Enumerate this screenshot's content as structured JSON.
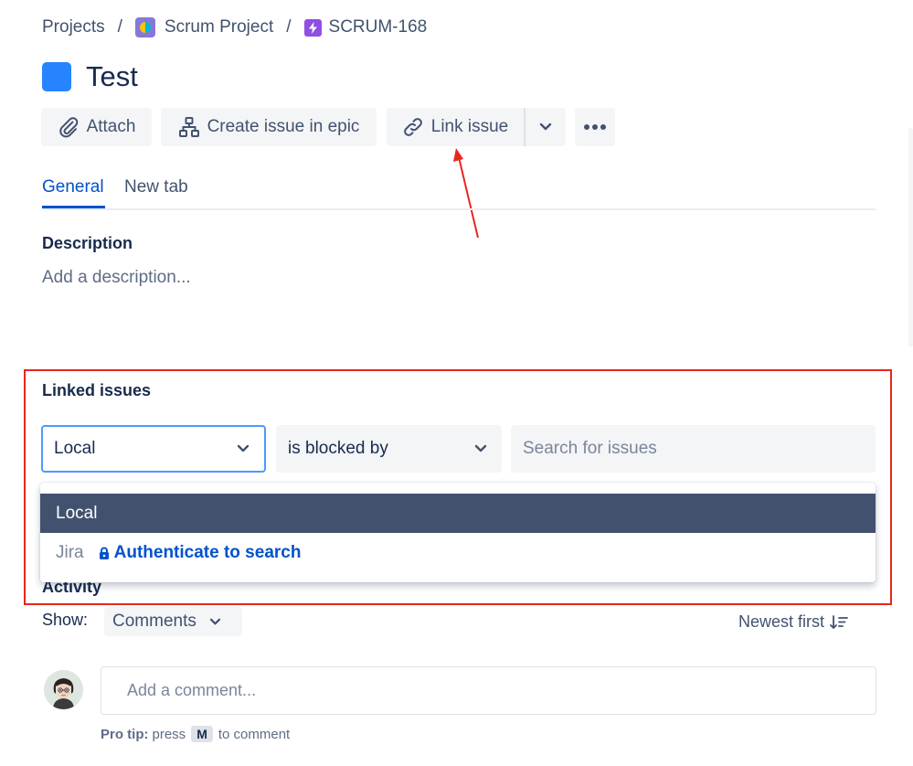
{
  "breadcrumb": {
    "projects": "Projects",
    "separator": "/",
    "project_name": "Scrum Project",
    "issue_key": "SCRUM-168"
  },
  "issue": {
    "title": "Test"
  },
  "toolbar": {
    "attach": "Attach",
    "create_in_epic": "Create issue in epic",
    "link_issue": "Link issue"
  },
  "tabs": [
    {
      "label": "General",
      "active": true
    },
    {
      "label": "New tab",
      "active": false
    }
  ],
  "description": {
    "heading": "Description",
    "placeholder": "Add a description..."
  },
  "linked_issues": {
    "heading": "Linked issues",
    "source_select": "Local",
    "relation_select": "is blocked by",
    "search_placeholder": "Search for issues",
    "menu": {
      "selected_option": "Local",
      "jira_label": "Jira",
      "auth_link": "Authenticate to search"
    }
  },
  "activity": {
    "heading": "Activity",
    "show_label": "Show:",
    "filter": "Comments",
    "sort": "Newest first",
    "comment_placeholder": "Add a comment...",
    "protip_bold": "Pro tip:",
    "protip_press": "press",
    "protip_key": "M",
    "protip_suffix": "to comment"
  },
  "colors": {
    "accent": "#0052cc",
    "highlight_border": "#e8271c",
    "selected_option_bg": "#42526e",
    "epic_icon": "#2684ff"
  },
  "icons": [
    "paperclip-icon",
    "hierarchy-icon",
    "link-icon",
    "chevron-down-icon",
    "more-icon",
    "lock-icon",
    "sort-icon"
  ]
}
